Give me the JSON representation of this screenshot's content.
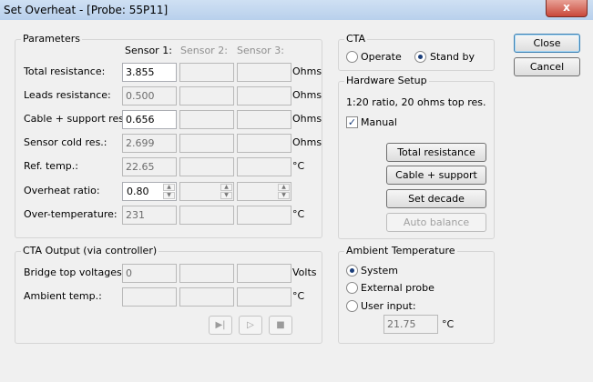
{
  "window": {
    "title": "Set Overheat - [Probe: 55P11]",
    "close_glyph": "x"
  },
  "parameters": {
    "legend": "Parameters",
    "headers": [
      "Sensor 1:",
      "Sensor 2:",
      "Sensor 3:"
    ],
    "rows": [
      {
        "label": "Total resistance:",
        "s1": "3.855",
        "unit": "Ohms"
      },
      {
        "label": "Leads resistance:",
        "s1": "0.500",
        "unit": "Ohms"
      },
      {
        "label": "Cable + support res.:",
        "s1": "0.656",
        "unit": "Ohms"
      },
      {
        "label": "Sensor cold res.:",
        "s1": "2.699",
        "unit": "Ohms"
      },
      {
        "label": "Ref. temp.:",
        "s1": "22.65",
        "unit": "°C"
      },
      {
        "label": "Overheat ratio:",
        "s1": "0.80",
        "unit": ""
      },
      {
        "label": "Over-temperature:",
        "s1": "231",
        "unit": "°C"
      }
    ]
  },
  "cta_output": {
    "legend": "CTA Output (via controller)",
    "rows": [
      {
        "label": "Bridge top voltages:",
        "s1": "0",
        "unit": "Volts"
      },
      {
        "label": "Ambient temp.:",
        "s1": "",
        "unit": "°C"
      }
    ],
    "controls": {
      "step_glyph": "▶|",
      "play_glyph": "▷",
      "stop_glyph": "■"
    }
  },
  "cta": {
    "legend": "CTA",
    "operate_label": "Operate",
    "standby_label": "Stand by",
    "selected": "Stand by"
  },
  "hardware": {
    "legend": "Hardware Setup",
    "info": "1:20 ratio, 20 ohms top res.",
    "manual_label": "Manual",
    "manual_checked": true,
    "buttons": [
      "Total resistance",
      "Cable + support",
      "Set decade",
      "Auto balance"
    ]
  },
  "ambient": {
    "legend": "Ambient Temperature",
    "options": [
      "System",
      "External probe",
      "User input:"
    ],
    "selected": "System",
    "user_value": "21.75",
    "unit": "°C"
  },
  "dialog_buttons": {
    "close": "Close",
    "cancel": "Cancel"
  }
}
